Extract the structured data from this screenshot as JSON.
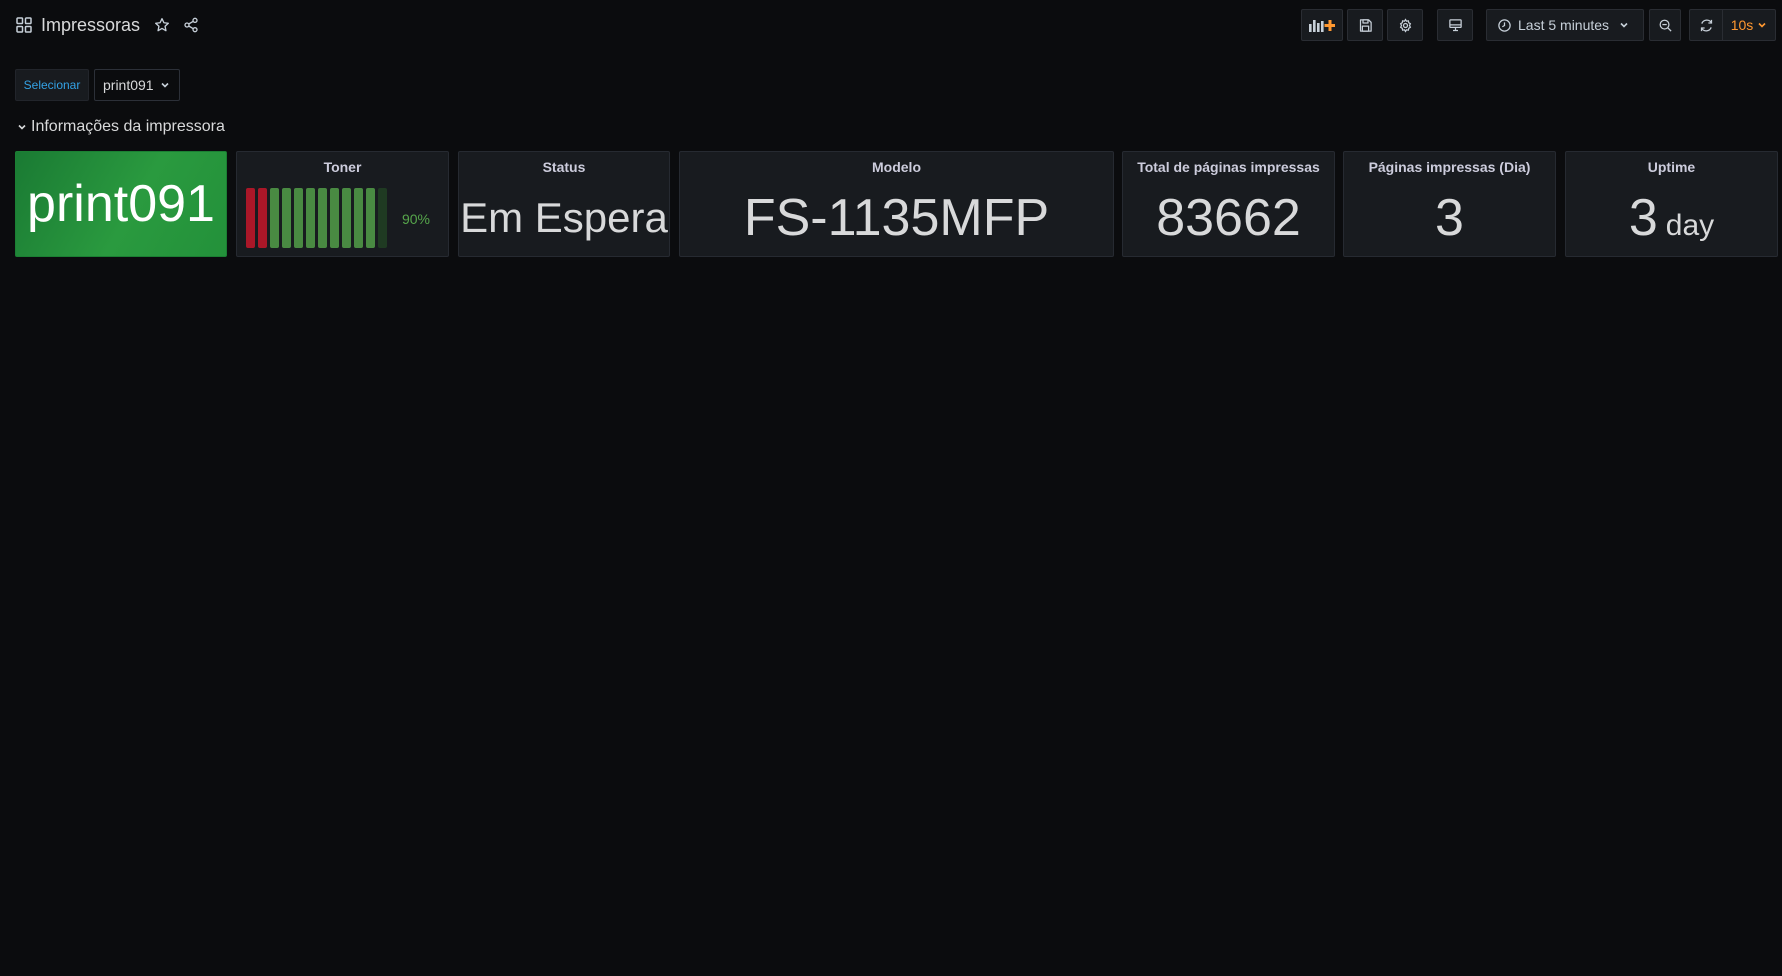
{
  "header": {
    "title": "Impressoras",
    "time_range": "Last 5 minutes",
    "refresh_interval": "10s"
  },
  "variables": {
    "label": "Selecionar",
    "selected": "print091"
  },
  "row": {
    "title": "Informações da impressora"
  },
  "panels": {
    "printer": {
      "value": "print091"
    },
    "toner": {
      "title": "Toner",
      "percent_label": "90%",
      "level": 0.9,
      "segments": 12,
      "colors": {
        "low": "#c4162a",
        "ok": "#56a64b",
        "empty": "#1f3a22",
        "text": "#56a64b"
      }
    },
    "status": {
      "title": "Status",
      "value": "Em Espera"
    },
    "model": {
      "title": "Modelo",
      "value": "FS-1135MFP"
    },
    "total_pages": {
      "title": "Total de páginas impressas",
      "value": "83662"
    },
    "pages_day": {
      "title": "Páginas impressas (Dia)",
      "value": "3"
    },
    "uptime": {
      "title": "Uptime",
      "value": "3",
      "unit": "day"
    }
  },
  "theme": {
    "background": "#0b0c0e",
    "panel": "#181b1f",
    "accent_blue": "#33a2e5",
    "accent_orange": "#ff9830",
    "panel_green": "#23913a"
  }
}
